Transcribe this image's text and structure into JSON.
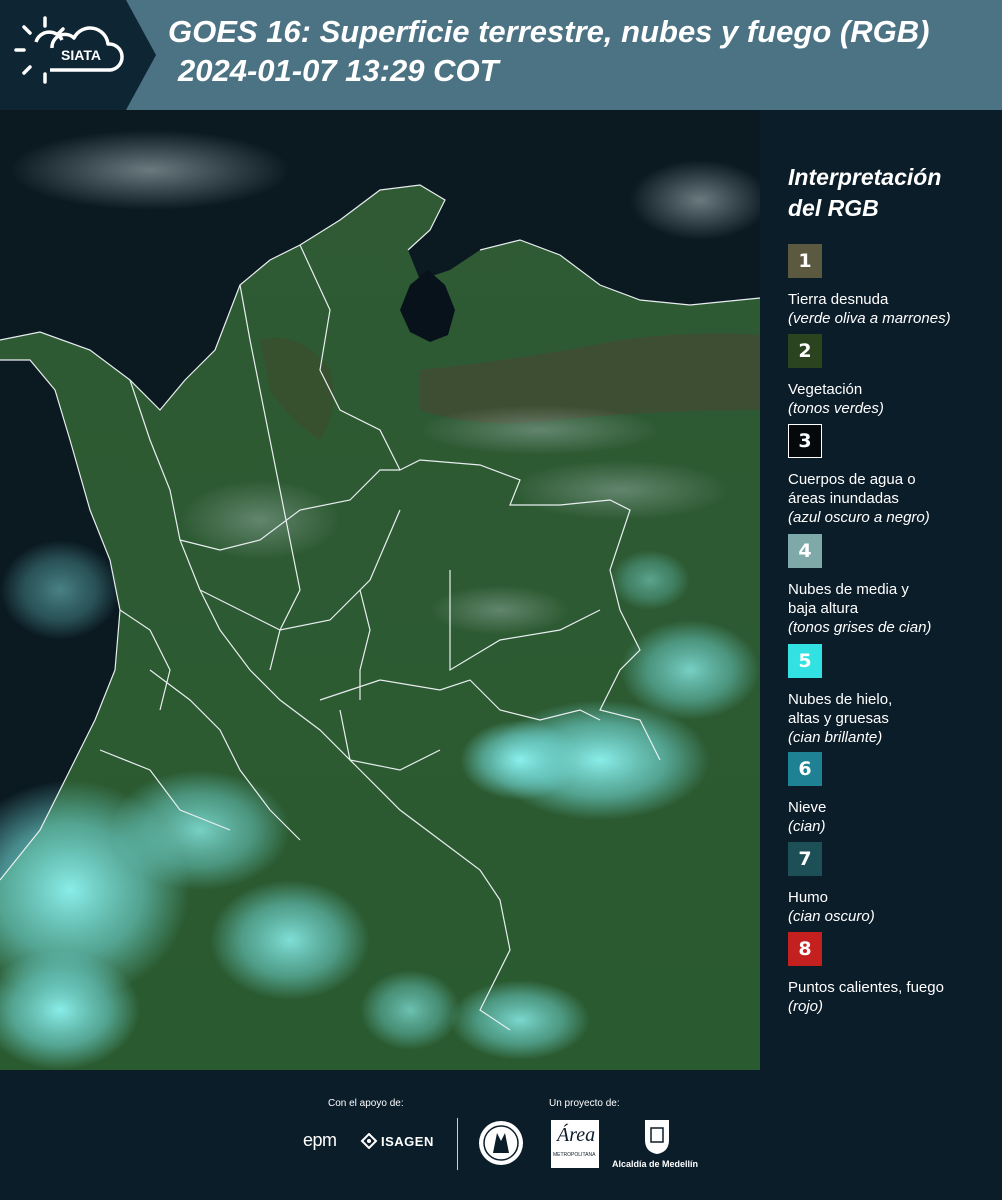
{
  "header": {
    "brand": "SIATA",
    "title": "GOES 16: Superficie terrestre, nubes y fuego (RGB)",
    "subtitle": "2024-01-07 13:29 COT"
  },
  "legend": {
    "title_line1": "Interpretación",
    "title_line2": "del RGB",
    "items": [
      {
        "number": "1",
        "color": "#5b5a41",
        "label1": "Tierra desnuda",
        "label2": "",
        "note": "(verde oliva a marrones)"
      },
      {
        "number": "2",
        "color": "#2c4320",
        "label1": "Vegetación",
        "label2": "",
        "note": "(tonos verdes)"
      },
      {
        "number": "3",
        "color": "#05090c",
        "label1": "Cuerpos de agua o",
        "label2": "áreas inundadas",
        "note": "(azul oscuro a negro)"
      },
      {
        "number": "4",
        "color": "#7fa9a9",
        "label1": "Nubes de media y",
        "label2": "baja altura",
        "note": "(tonos grises de cian)"
      },
      {
        "number": "5",
        "color": "#32e1e1",
        "label1": "Nubes de hielo,",
        "label2": "altas y gruesas",
        "note": "(cian brillante)"
      },
      {
        "number": "6",
        "color": "#1e8294",
        "label1": "Nieve",
        "label2": "",
        "note": "(cian)"
      },
      {
        "number": "7",
        "color": "#1d4f56",
        "label1": "Humo",
        "label2": "",
        "note": "(cian oscuro)"
      },
      {
        "number": "8",
        "color": "#c42020",
        "label1": "Puntos calientes, fuego",
        "label2": "",
        "note": "(rojo)"
      }
    ]
  },
  "footer": {
    "support_label": "Con el apoyo de:",
    "project_label": "Un proyecto de:",
    "sponsor_epm": "epm",
    "sponsor_isagen": "ISAGEN",
    "sponsor_area": "Área",
    "sponsor_area_sub": "METROPOLITANA",
    "sponsor_alcaldia": "Alcaldía de Medellín"
  }
}
